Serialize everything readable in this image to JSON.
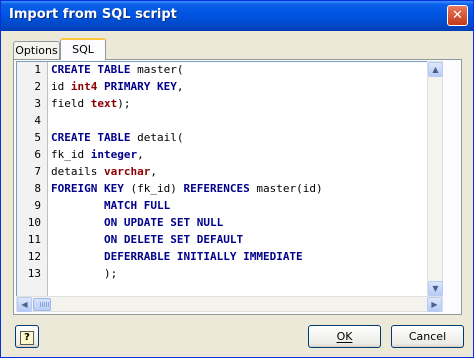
{
  "window": {
    "title": "Import from SQL script",
    "close_glyph": "✕"
  },
  "tabs": [
    {
      "label": "Options",
      "active": false
    },
    {
      "label": "SQL",
      "active": true
    }
  ],
  "editor": {
    "lines": [
      {
        "n": "1",
        "text": "CREATE TABLE master("
      },
      {
        "n": "2",
        "text": "id int4 PRIMARY KEY,"
      },
      {
        "n": "3",
        "text": "field text);"
      },
      {
        "n": "4",
        "text": ""
      },
      {
        "n": "5",
        "text": "CREATE TABLE detail("
      },
      {
        "n": "6",
        "text": "fk_id integer,"
      },
      {
        "n": "7",
        "text": "details varchar,"
      },
      {
        "n": "8",
        "text": "FOREIGN KEY (fk_id) REFERENCES master(id)"
      },
      {
        "n": "9",
        "text": "        MATCH FULL"
      },
      {
        "n": "10",
        "text": "        ON UPDATE SET NULL"
      },
      {
        "n": "11",
        "text": "        ON DELETE SET DEFAULT"
      },
      {
        "n": "12",
        "text": "        DEFERRABLE INITIALLY IMMEDIATE"
      },
      {
        "n": "13",
        "text": "        );"
      }
    ],
    "keyword_color": "#00008B",
    "type_color": "#8B0000"
  },
  "buttons": {
    "help_glyph": "?",
    "ok_label": "OK",
    "cancel_label": "Cancel"
  },
  "scrollbars": {
    "up": "▲",
    "down": "▼",
    "left": "◀",
    "right": "▶"
  }
}
